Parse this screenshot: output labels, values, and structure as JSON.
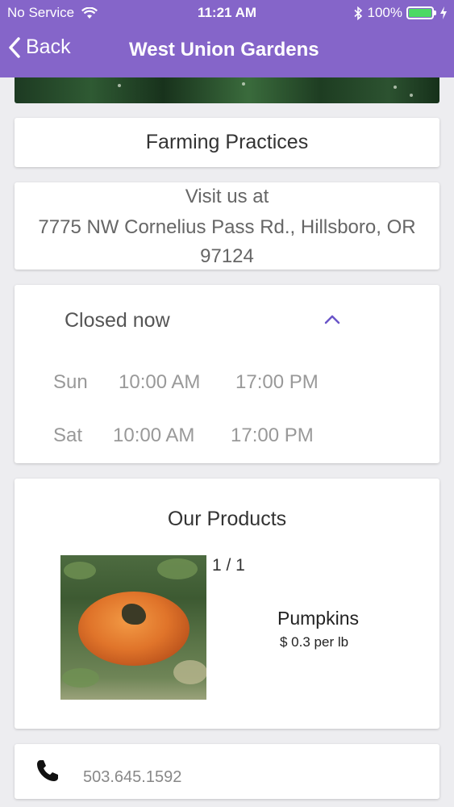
{
  "status_bar": {
    "carrier": "No Service",
    "time": "11:21 AM",
    "battery": "100%",
    "battery_level": 1.0
  },
  "nav": {
    "back_label": "Back",
    "title": "West Union Gardens"
  },
  "farming": {
    "label": "Farming Practices"
  },
  "visit": {
    "label": "Visit us at",
    "address_line1": "7775 NW Cornelius Pass Rd., Hillsboro, OR",
    "address_line2": "97124"
  },
  "hours": {
    "status": "Closed now",
    "rows": [
      {
        "day": "Sun",
        "open": "10:00 AM",
        "close": "17:00 PM"
      },
      {
        "day": "Sat",
        "open": "10:00 AM",
        "close": "17:00 PM"
      }
    ]
  },
  "products": {
    "title": "Our Products",
    "pager": "1 / 1",
    "items": [
      {
        "name": "Pumpkins",
        "price": "$ 0.3 per lb"
      }
    ]
  },
  "contact": {
    "phone": "503.645.1592"
  },
  "colors": {
    "header": "#8565c9",
    "accent": "#6a55c8",
    "background": "#ededf0",
    "battery_fill": "#4cd964"
  }
}
